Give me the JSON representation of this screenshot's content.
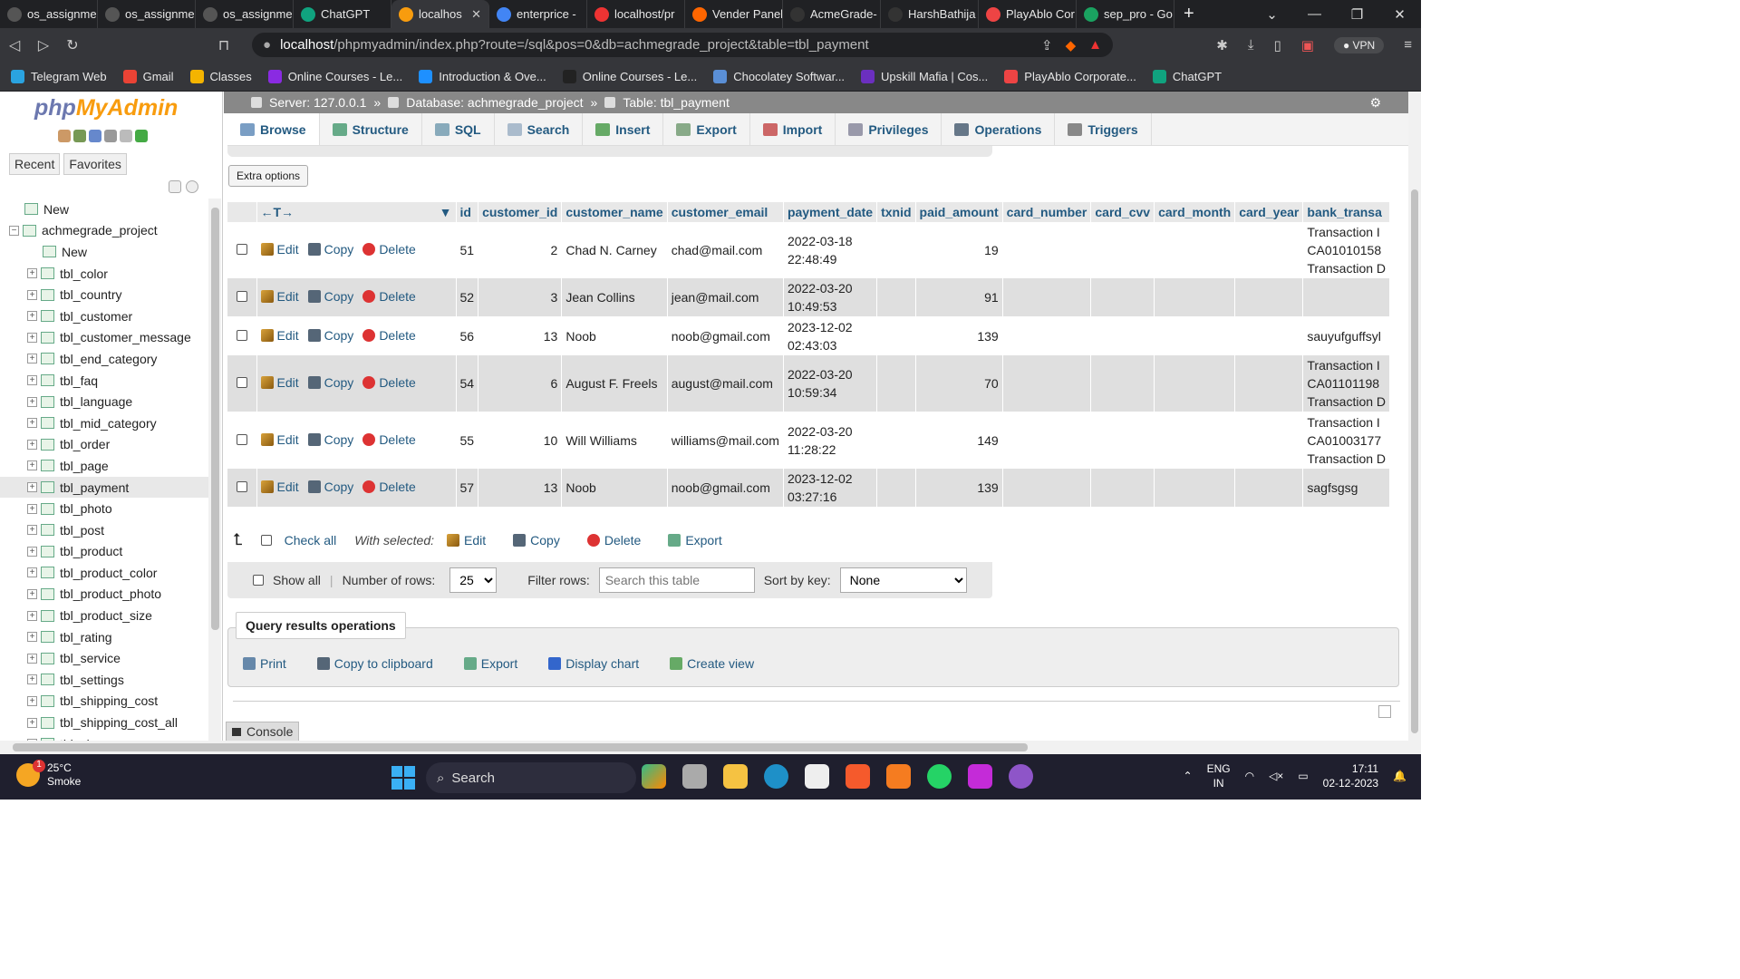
{
  "browser": {
    "tabs": [
      {
        "title": "os_assignme",
        "color": "#555"
      },
      {
        "title": "os_assignme",
        "color": "#555"
      },
      {
        "title": "os_assignme",
        "color": "#555"
      },
      {
        "title": "ChatGPT",
        "color": "#10a37f"
      },
      {
        "title": "localhos",
        "color": "#f89c0e",
        "active": true
      },
      {
        "title": "enterprice -",
        "color": "#4285f4"
      },
      {
        "title": "localhost/pr",
        "color": "#e33"
      },
      {
        "title": "Vender Panel",
        "color": "#f60"
      },
      {
        "title": "AcmeGrade-",
        "color": "#333"
      },
      {
        "title": "HarshBathija",
        "color": "#333"
      },
      {
        "title": "PlayAblo Cor",
        "color": "#e44"
      },
      {
        "title": "sep_pro - Go",
        "color": "#1aa260"
      }
    ],
    "url_host": "localhost",
    "url_path": "/phpmyadmin/index.php?route=/sql&pos=0&db=achmegrade_project&table=tbl_payment",
    "vpn_label": "VPN",
    "bookmarks": [
      {
        "label": "Telegram Web",
        "color": "#2aa3e0"
      },
      {
        "label": "Gmail",
        "color": "#ea4335"
      },
      {
        "label": "Classes",
        "color": "#f4b400"
      },
      {
        "label": "Online Courses - Le...",
        "color": "#8a2be2"
      },
      {
        "label": "Introduction & Ove...",
        "color": "#1e90ff"
      },
      {
        "label": "Online Courses - Le...",
        "color": "#222"
      },
      {
        "label": "Chocolatey Softwar...",
        "color": "#5a8fd6"
      },
      {
        "label": "Upskill Mafia | Cos...",
        "color": "#6b2fbf"
      },
      {
        "label": "PlayAblo Corporate...",
        "color": "#e44"
      },
      {
        "label": "ChatGPT",
        "color": "#10a37f"
      }
    ]
  },
  "pma": {
    "logo_php": "php",
    "logo_my": "MyAdmin",
    "recent": "Recent",
    "favorites": "Favorites",
    "tree_new": "New",
    "db_name": "achmegrade_project",
    "db_new": "New",
    "tables": [
      "tbl_color",
      "tbl_country",
      "tbl_customer",
      "tbl_customer_message",
      "tbl_end_category",
      "tbl_faq",
      "tbl_language",
      "tbl_mid_category",
      "tbl_order",
      "tbl_page",
      "tbl_payment",
      "tbl_photo",
      "tbl_post",
      "tbl_product",
      "tbl_product_color",
      "tbl_product_photo",
      "tbl_product_size",
      "tbl_rating",
      "tbl_service",
      "tbl_settings",
      "tbl_shipping_cost",
      "tbl_shipping_cost_all",
      "tbl_size"
    ],
    "selected_table": "tbl_payment",
    "crumb_server": "Server: 127.0.0.1",
    "crumb_db": "Database: achmegrade_project",
    "crumb_table": "Table: tbl_payment",
    "tabs": [
      "Browse",
      "Structure",
      "SQL",
      "Search",
      "Insert",
      "Export",
      "Import",
      "Privileges",
      "Operations",
      "Triggers"
    ],
    "extra_options": "Extra options",
    "columns": [
      "id",
      "customer_id",
      "customer_name",
      "customer_email",
      "payment_date",
      "txnid",
      "paid_amount",
      "card_number",
      "card_cvv",
      "card_month",
      "card_year",
      "bank_transa"
    ],
    "row_actions": {
      "edit": "Edit",
      "copy": "Copy",
      "delete": "Delete"
    },
    "rows": [
      {
        "id": "51",
        "customer_id": "2",
        "customer_name": "Chad N. Carney",
        "customer_email": "chad@mail.com",
        "date": "2022-03-18",
        "time": "22:48:49",
        "paid_amount": "19",
        "bank": [
          "Transaction I",
          "CA01010158",
          "Transaction D"
        ]
      },
      {
        "id": "52",
        "customer_id": "3",
        "customer_name": "Jean Collins",
        "customer_email": "jean@mail.com",
        "date": "2022-03-20",
        "time": "10:49:53",
        "paid_amount": "91",
        "bank": []
      },
      {
        "id": "56",
        "customer_id": "13",
        "customer_name": "Noob",
        "customer_email": "noob@gmail.com",
        "date": "2023-12-02",
        "time": "02:43:03",
        "paid_amount": "139",
        "bank": [
          "sauyufguffsyl"
        ]
      },
      {
        "id": "54",
        "customer_id": "6",
        "customer_name": "August F. Freels",
        "customer_email": "august@mail.com",
        "date": "2022-03-20",
        "time": "10:59:34",
        "paid_amount": "70",
        "bank": [
          "Transaction I",
          "CA01101198",
          "Transaction D"
        ]
      },
      {
        "id": "55",
        "customer_id": "10",
        "customer_name": "Will Williams",
        "customer_email": "williams@mail.com",
        "date": "2022-03-20",
        "time": "11:28:22",
        "paid_amount": "149",
        "bank": [
          "Transaction I",
          "CA01003177",
          "Transaction D"
        ]
      },
      {
        "id": "57",
        "customer_id": "13",
        "customer_name": "Noob",
        "customer_email": "noob@gmail.com",
        "date": "2023-12-02",
        "time": "03:27:16",
        "paid_amount": "139",
        "bank": [
          "sagfsgsg"
        ]
      }
    ],
    "check_all": "Check all",
    "with_selected": "With selected:",
    "bulk": {
      "edit": "Edit",
      "copy": "Copy",
      "delete": "Delete",
      "export": "Export"
    },
    "show_all": "Show all",
    "rows_label": "Number of rows:",
    "rows_value": "25",
    "filter_label": "Filter rows:",
    "filter_placeholder": "Search this table",
    "sort_label": "Sort by key:",
    "sort_value": "None",
    "qro_title": "Query results operations",
    "qro_ops": [
      "Print",
      "Copy to clipboard",
      "Export",
      "Display chart",
      "Create view"
    ],
    "console": "Console"
  },
  "taskbar": {
    "temp": "25°C",
    "weather": "Smoke",
    "weather_badge": "1",
    "search": "Search",
    "lang1": "ENG",
    "lang2": "IN",
    "time": "17:11",
    "date": "02-12-2023"
  }
}
